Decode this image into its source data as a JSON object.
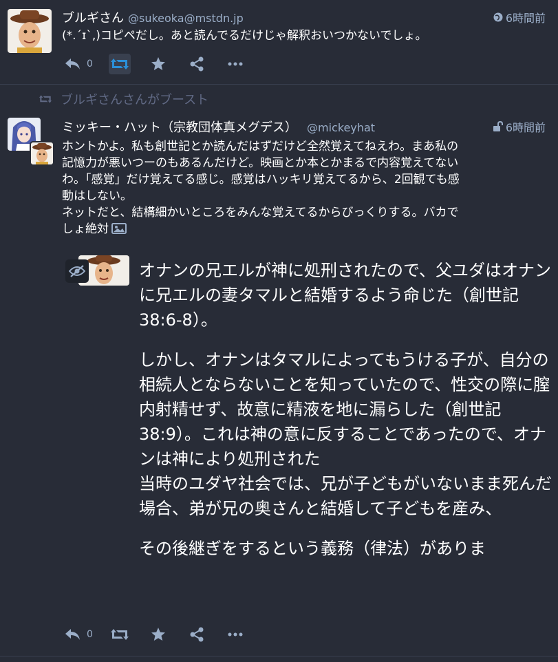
{
  "status1": {
    "display_name": "ブルギさん",
    "handle": "@sukeoka@mstdn.jp",
    "time": "6時間前",
    "content": "(*.´ɪ`,)コピペだし。あと読んでるだけじゃ解釈おいつかないでしょ。",
    "reply_count": "0",
    "visibility_icon": "globe-icon"
  },
  "status2": {
    "boost_text": "ブルギさんさんがブースト",
    "display_name": "ミッキー・ハット（宗教団体真メグデス）",
    "handle": "@mickeyhat",
    "time": "6時間前",
    "content_lines": [
      "ホントかよ。私も創世記とか読んだはずだけど全然覚えてねえわ。まあ私の",
      "記憶力が悪いつーのもあるんだけど。映画とか本とかまるで内容覚えてない",
      "わ。「感覚」だけ覚えてる感じ。感覚はハッキリ覚えてるから、2回観ても感",
      "動はしない。",
      "ネットだと、結構細かいところをみんな覚えてるからびっくりする。バカで",
      "しょ絶対"
    ],
    "reply_count": "0",
    "visibility_icon": "unlock-icon",
    "media_paragraphs": [
      "オナンの兄エルが神に処刑されたので、父ユダはオナンに兄エルの妻タマルと結婚するよう命じた（創世記38:6-8）。",
      "しかし、オナンはタマルによってもうける子が、自分の相続人とならないことを知っていたので、性交の際に膣内射精せず、故意に精液を地に漏らした（創世記38:9）。これは神の意に反することであったので、オナンは神により処刑された\n当時のユダヤ社会では、兄が子どもがいないまま死んだ場合、弟が兄の奥さんと結婚して子どもを産み、",
      "その後継ぎをするという義務（律法）がありま"
    ]
  },
  "colors": {
    "background": "#282c37",
    "muted": "#9baec8",
    "boost_active": "#2b90d9"
  }
}
